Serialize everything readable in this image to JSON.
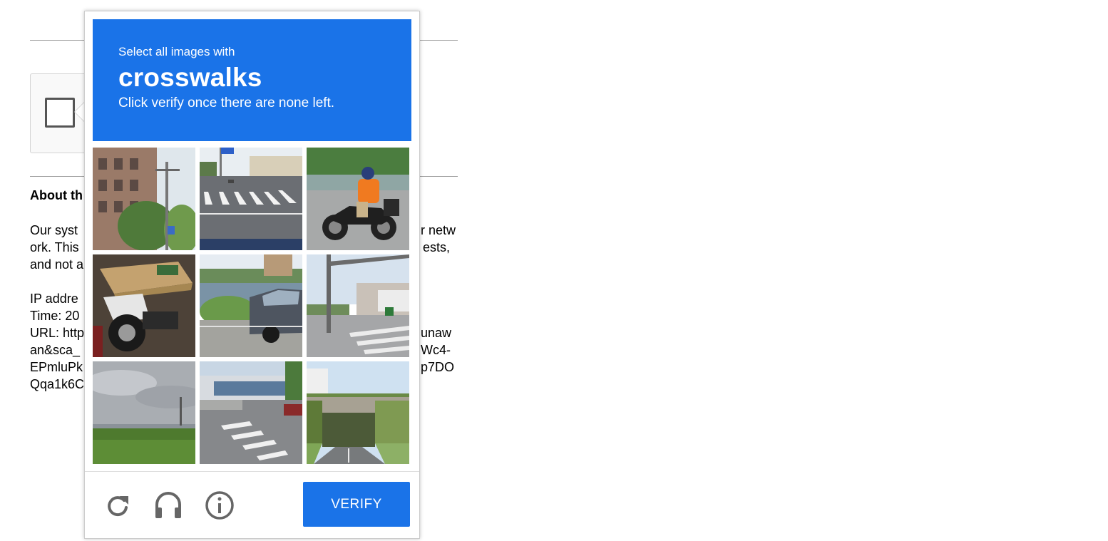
{
  "background_page": {
    "heading": "About th",
    "paragraph_lines": [
      "Our syst",
      "ork. This",
      "and not a"
    ],
    "paragraph_right_lines": [
      "r netw",
      "ests,"
    ],
    "info_lines": [
      "IP addre",
      "Time: 20",
      "URL: http",
      "an&sca_",
      "EPmluPk",
      "Qqa1k6C"
    ],
    "info_right_lines": [
      "unaw",
      "Wc4-",
      "p7DO"
    ]
  },
  "challenge": {
    "instruction_prefix": "Select all images with",
    "target": "crosswalks",
    "hint": "Click verify once there are none left.",
    "tiles": [
      {
        "id": 1,
        "scene": "brick apartment building with trees and utility pole"
      },
      {
        "id": 2,
        "scene": "wide road with crosswalk stripes"
      },
      {
        "id": 3,
        "scene": "rider in orange shirt on motorcycle"
      },
      {
        "id": 4,
        "scene": "scooter with cardboard box"
      },
      {
        "id": 5,
        "scene": "parked car by lake"
      },
      {
        "id": 6,
        "scene": "street corner with traffic pole"
      },
      {
        "id": 7,
        "scene": "bridge over grassy field under cloudy sky"
      },
      {
        "id": 8,
        "scene": "intersection with crosswalk near building"
      },
      {
        "id": 9,
        "scene": "road passing under a railway bridge"
      }
    ],
    "tools": {
      "reload_icon": "reload-icon",
      "audio_icon": "headphones-icon",
      "info_icon": "info-icon"
    },
    "verify_label": "VERIFY",
    "accent_color": "#1a73e8"
  }
}
